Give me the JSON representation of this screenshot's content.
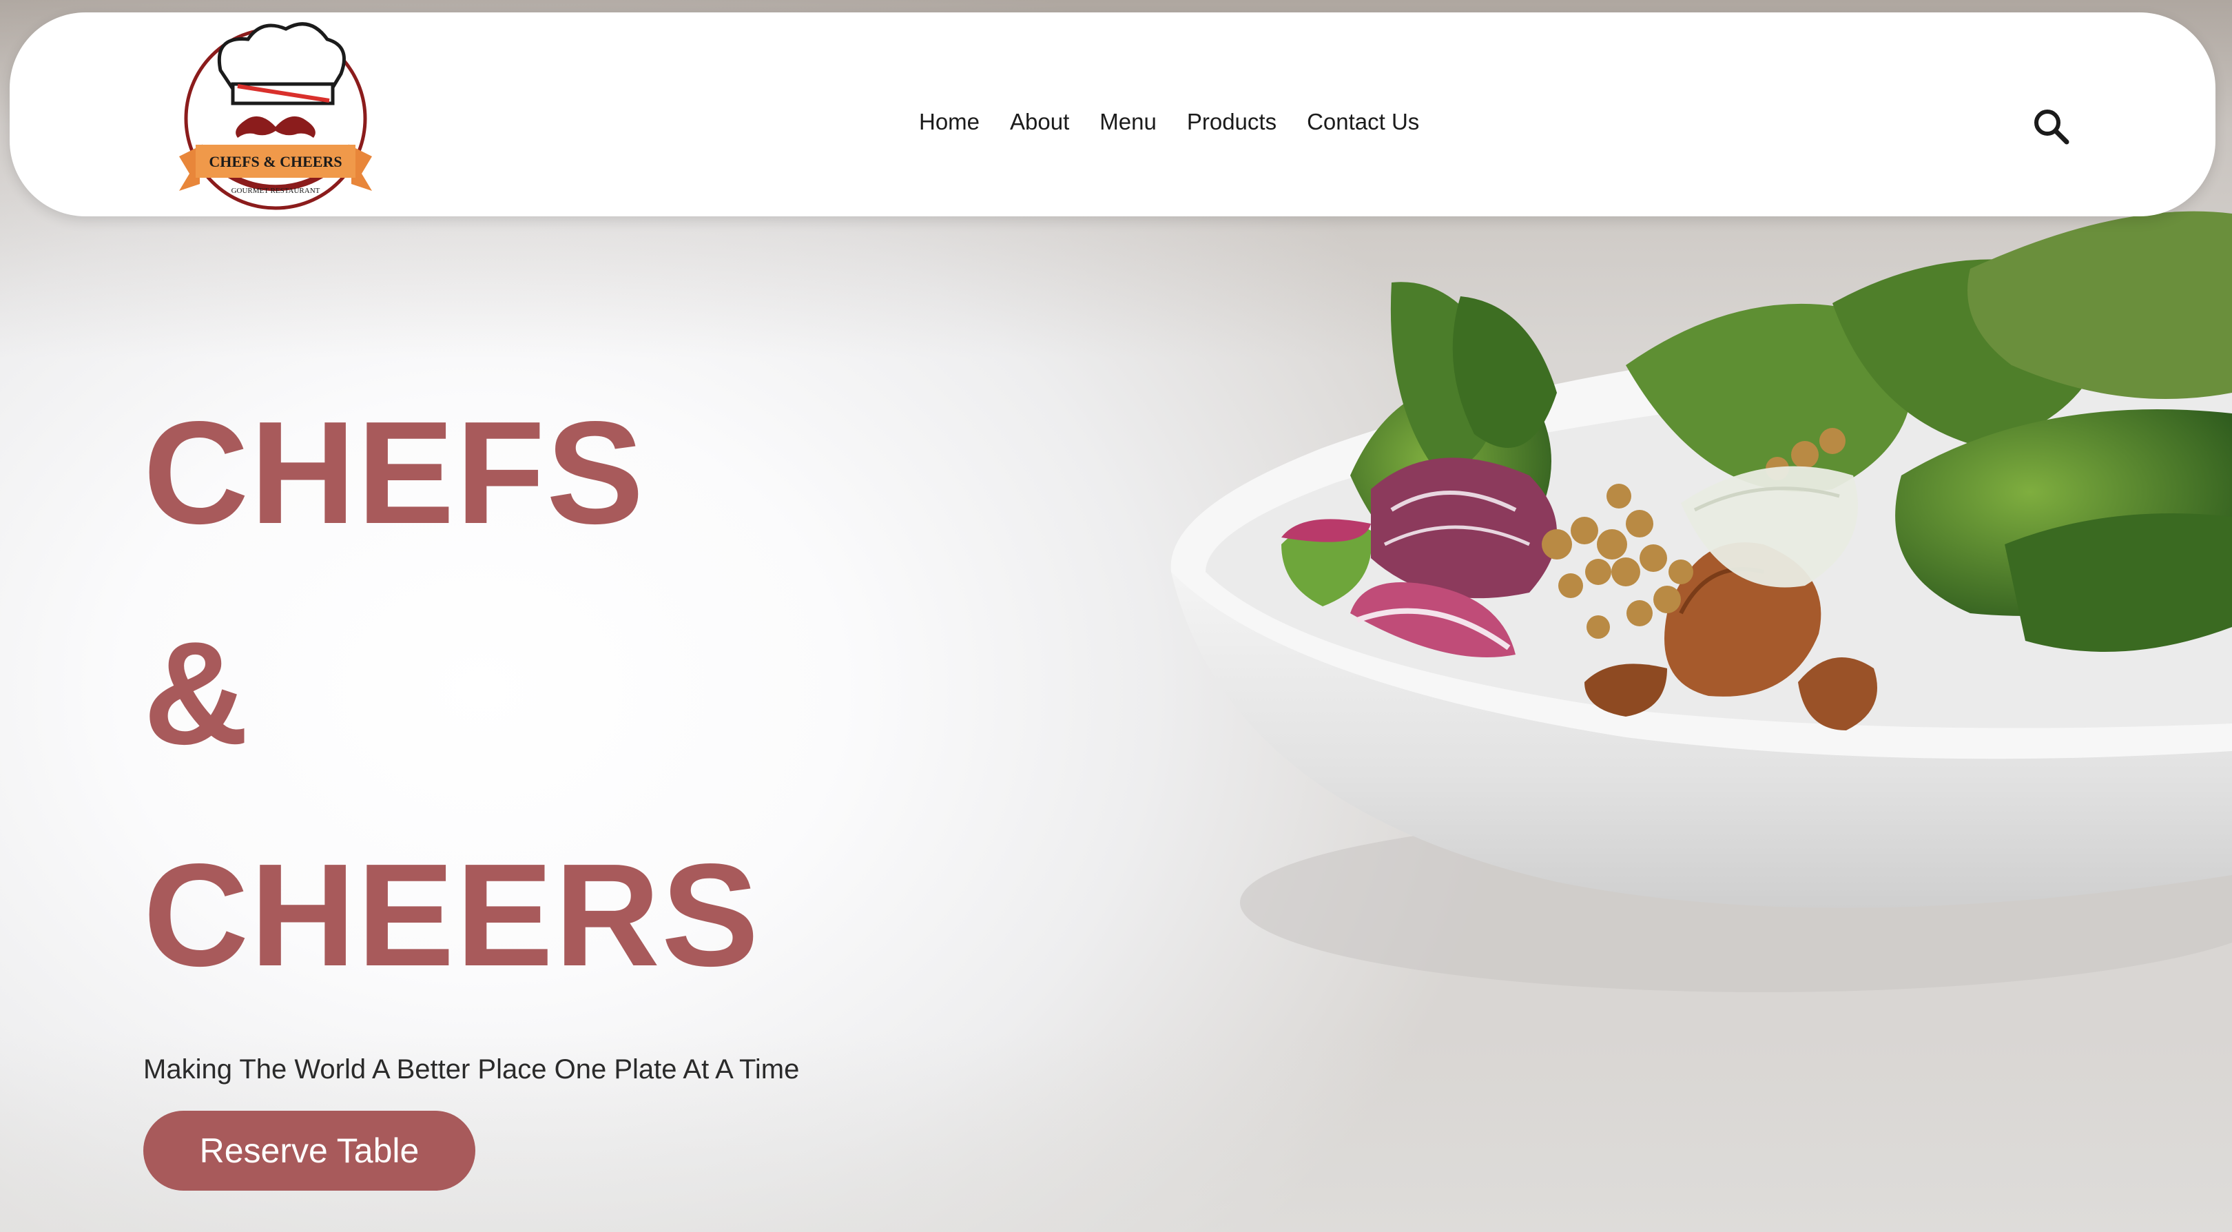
{
  "brand": {
    "logo_text": "CHEFS & CHEERS",
    "logo_subtext": "GOURMET RESTAURANT"
  },
  "nav": {
    "items": [
      "Home",
      "About",
      "Menu",
      "Products",
      "Contact Us"
    ]
  },
  "hero": {
    "line1": "CHEFS",
    "line2": "&",
    "line3": "CHEERS",
    "tagline": "Making The World A Better Place One Plate At A Time",
    "cta": "Reserve Table"
  },
  "colors": {
    "accent": "#a85a5b",
    "text": "#1b1b1b"
  },
  "icons": {
    "search": "search-icon",
    "logo": "chef-hat-mustache-logo"
  }
}
